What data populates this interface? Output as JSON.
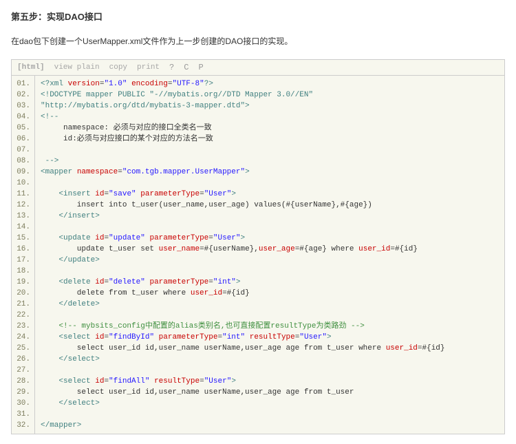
{
  "heading": "第五步：实现DAO接口",
  "description": "在dao包下创建一个UserMapper.xml文件作为上一步创建的DAO接口的实现。",
  "toolbar": {
    "lang": "[html]",
    "view_plain": "view plain",
    "copy": "copy",
    "print": "print",
    "q": "?"
  },
  "code": {
    "line_count": 32,
    "lines": [
      [
        {
          "t": "tag",
          "v": "<?xml"
        },
        {
          "t": "txt",
          "v": " "
        },
        {
          "t": "attr",
          "v": "version"
        },
        {
          "t": "punc",
          "v": "="
        },
        {
          "t": "str",
          "v": "\"1.0\""
        },
        {
          "t": "txt",
          "v": " "
        },
        {
          "t": "attr",
          "v": "encoding"
        },
        {
          "t": "punc",
          "v": "="
        },
        {
          "t": "str",
          "v": "\"UTF-8\""
        },
        {
          "t": "tag",
          "v": "?>"
        }
      ],
      [
        {
          "t": "tag",
          "v": "<!DOCTYPE mapper PUBLIC \"-//mybatis.org//DTD Mapper 3.0//EN\""
        }
      ],
      [
        {
          "t": "tag",
          "v": "\"http://mybatis.org/dtd/mybatis-3-mapper.dtd\">"
        }
      ],
      [
        {
          "t": "tag",
          "v": "<!--"
        }
      ],
      [
        {
          "t": "txt",
          "v": "     namespace: 必须与对应的接口全类名一致"
        }
      ],
      [
        {
          "t": "txt",
          "v": "     id:必须与对应接口的某个对应的方法名一致"
        }
      ],
      [
        {
          "t": "txt",
          "v": "      "
        }
      ],
      [
        {
          "t": "txt",
          "v": " "
        },
        {
          "t": "tag",
          "v": "-->"
        }
      ],
      [
        {
          "t": "tag",
          "v": "<mapper"
        },
        {
          "t": "txt",
          "v": " "
        },
        {
          "t": "attr",
          "v": "namespace"
        },
        {
          "t": "punc",
          "v": "="
        },
        {
          "t": "str",
          "v": "\"com.tgb.mapper.UserMapper\""
        },
        {
          "t": "tag",
          "v": ">"
        }
      ],
      [
        {
          "t": "txt",
          "v": "  "
        }
      ],
      [
        {
          "t": "txt",
          "v": "    "
        },
        {
          "t": "tag",
          "v": "<insert"
        },
        {
          "t": "txt",
          "v": " "
        },
        {
          "t": "attr",
          "v": "id"
        },
        {
          "t": "punc",
          "v": "="
        },
        {
          "t": "str",
          "v": "\"save\""
        },
        {
          "t": "txt",
          "v": " "
        },
        {
          "t": "attr",
          "v": "parameterType"
        },
        {
          "t": "punc",
          "v": "="
        },
        {
          "t": "str",
          "v": "\"User\""
        },
        {
          "t": "tag",
          "v": ">"
        }
      ],
      [
        {
          "t": "txt",
          "v": "        insert into t_user(user_name,user_age) values(#{userName},#{age})"
        }
      ],
      [
        {
          "t": "txt",
          "v": "    "
        },
        {
          "t": "tag",
          "v": "</insert>"
        }
      ],
      [
        {
          "t": "txt",
          "v": "  "
        }
      ],
      [
        {
          "t": "txt",
          "v": "    "
        },
        {
          "t": "tag",
          "v": "<update"
        },
        {
          "t": "txt",
          "v": " "
        },
        {
          "t": "attr",
          "v": "id"
        },
        {
          "t": "punc",
          "v": "="
        },
        {
          "t": "str",
          "v": "\"update\""
        },
        {
          "t": "txt",
          "v": " "
        },
        {
          "t": "attr",
          "v": "parameterType"
        },
        {
          "t": "punc",
          "v": "="
        },
        {
          "t": "str",
          "v": "\"User\""
        },
        {
          "t": "tag",
          "v": ">"
        }
      ],
      [
        {
          "t": "txt",
          "v": "        update t_user set "
        },
        {
          "t": "attr",
          "v": "user_name"
        },
        {
          "t": "txt",
          "v": "=#{userName},"
        },
        {
          "t": "attr",
          "v": "user_age"
        },
        {
          "t": "txt",
          "v": "=#{age} where "
        },
        {
          "t": "attr",
          "v": "user_id"
        },
        {
          "t": "txt",
          "v": "=#{id}"
        }
      ],
      [
        {
          "t": "txt",
          "v": "    "
        },
        {
          "t": "tag",
          "v": "</update>"
        }
      ],
      [
        {
          "t": "txt",
          "v": "  "
        }
      ],
      [
        {
          "t": "txt",
          "v": "    "
        },
        {
          "t": "tag",
          "v": "<delete"
        },
        {
          "t": "txt",
          "v": " "
        },
        {
          "t": "attr",
          "v": "id"
        },
        {
          "t": "punc",
          "v": "="
        },
        {
          "t": "str",
          "v": "\"delete\""
        },
        {
          "t": "txt",
          "v": " "
        },
        {
          "t": "attr",
          "v": "parameterType"
        },
        {
          "t": "punc",
          "v": "="
        },
        {
          "t": "str",
          "v": "\"int\""
        },
        {
          "t": "tag",
          "v": ">"
        }
      ],
      [
        {
          "t": "txt",
          "v": "        delete from t_user where "
        },
        {
          "t": "attr",
          "v": "user_id"
        },
        {
          "t": "txt",
          "v": "=#{id}"
        }
      ],
      [
        {
          "t": "txt",
          "v": "    "
        },
        {
          "t": "tag",
          "v": "</delete>"
        }
      ],
      [
        {
          "t": "txt",
          "v": "  "
        }
      ],
      [
        {
          "t": "txt",
          "v": "    "
        },
        {
          "t": "cmt",
          "v": "<!-- mybsits_config中配置的alias类别名,也可直接配置resultType为类路劲 -->"
        }
      ],
      [
        {
          "t": "txt",
          "v": "    "
        },
        {
          "t": "tag",
          "v": "<select"
        },
        {
          "t": "txt",
          "v": " "
        },
        {
          "t": "attr",
          "v": "id"
        },
        {
          "t": "punc",
          "v": "="
        },
        {
          "t": "str",
          "v": "\"findById\""
        },
        {
          "t": "txt",
          "v": " "
        },
        {
          "t": "attr",
          "v": "parameterType"
        },
        {
          "t": "punc",
          "v": "="
        },
        {
          "t": "str",
          "v": "\"int\""
        },
        {
          "t": "txt",
          "v": " "
        },
        {
          "t": "attr",
          "v": "resultType"
        },
        {
          "t": "punc",
          "v": "="
        },
        {
          "t": "str",
          "v": "\"User\""
        },
        {
          "t": "tag",
          "v": ">"
        }
      ],
      [
        {
          "t": "txt",
          "v": "        select user_id id,user_name userName,user_age age from t_user where "
        },
        {
          "t": "attr",
          "v": "user_id"
        },
        {
          "t": "txt",
          "v": "=#{id}"
        }
      ],
      [
        {
          "t": "txt",
          "v": "    "
        },
        {
          "t": "tag",
          "v": "</select>"
        }
      ],
      [
        {
          "t": "txt",
          "v": "  "
        }
      ],
      [
        {
          "t": "txt",
          "v": "    "
        },
        {
          "t": "tag",
          "v": "<select"
        },
        {
          "t": "txt",
          "v": " "
        },
        {
          "t": "attr",
          "v": "id"
        },
        {
          "t": "punc",
          "v": "="
        },
        {
          "t": "str",
          "v": "\"findAll\""
        },
        {
          "t": "txt",
          "v": " "
        },
        {
          "t": "attr",
          "v": "resultType"
        },
        {
          "t": "punc",
          "v": "="
        },
        {
          "t": "str",
          "v": "\"User\""
        },
        {
          "t": "tag",
          "v": ">"
        }
      ],
      [
        {
          "t": "txt",
          "v": "        select user_id id,user_name userName,user_age age from t_user"
        }
      ],
      [
        {
          "t": "txt",
          "v": "    "
        },
        {
          "t": "tag",
          "v": "</select>"
        }
      ],
      [
        {
          "t": "txt",
          "v": "  "
        }
      ],
      [
        {
          "t": "tag",
          "v": "</mapper>"
        }
      ]
    ]
  }
}
